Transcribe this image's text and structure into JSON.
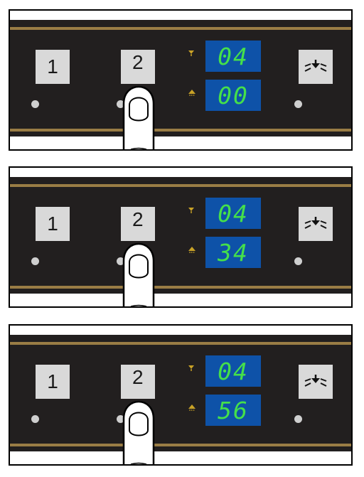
{
  "buttons": {
    "button_1": "1",
    "button_2": "2",
    "function_icon": "descale-icon"
  },
  "steps": [
    {
      "display_top": "04",
      "display_bottom": "00"
    },
    {
      "display_top": "04",
      "display_bottom": "34"
    },
    {
      "display_top": "04",
      "display_bottom": "56"
    }
  ],
  "colors": {
    "panel": "#221f1f",
    "trim": "#9a7d45",
    "display_background": "#0e52a8",
    "display_digits": "#45e04a",
    "indicator": "#c9a227"
  }
}
